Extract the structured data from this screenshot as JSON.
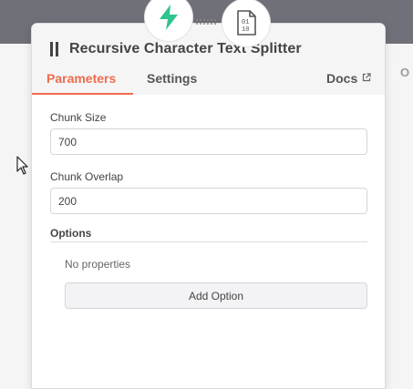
{
  "panel": {
    "title": "Recursive Character Text Splitter",
    "tabs": {
      "parameters": "Parameters",
      "settings": "Settings",
      "docs": "Docs"
    }
  },
  "fields": {
    "chunk_size": {
      "label": "Chunk Size",
      "value": "700"
    },
    "chunk_overlap": {
      "label": "Chunk Overlap",
      "value": "200"
    }
  },
  "options": {
    "label": "Options",
    "empty_text": "No properties",
    "add_button": "Add Option"
  },
  "right_edge": {
    "letter": "O"
  },
  "icons": {
    "left_connector": "lightning-bolt-icon",
    "right_connector": "binary-document-icon",
    "title": "drag-handle-icon",
    "docs": "external-link-icon"
  },
  "colors": {
    "accent": "#ee6c4d",
    "bolt": "#2fc48d",
    "topbar": "#707079",
    "panel_header": "#f5f5f6"
  }
}
